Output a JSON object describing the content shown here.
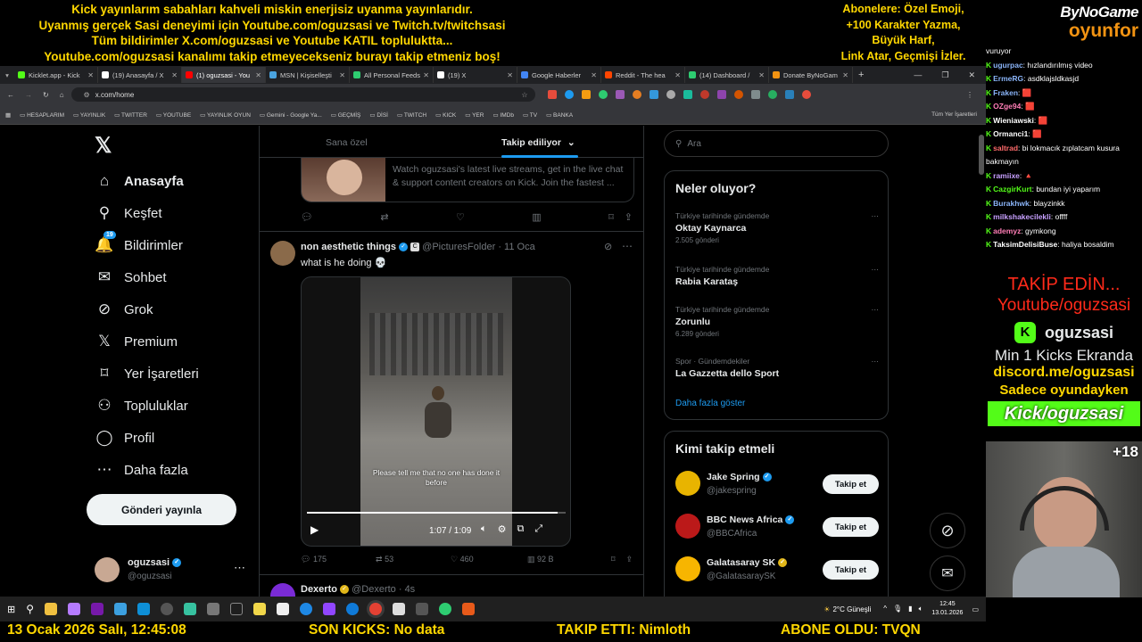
{
  "overlay": {
    "banner_lines": [
      "Kick yayınlarım sabahları kahveli miskin enerjisiz uyanma yayınlarıdır.",
      "Uyanmış gerçek Sasi deneyimi için Youtube.com/oguzsasi ve Twitch.tv/twitchsasi",
      "Tüm bildirimler X.com/oguzsasi ve Youtube KATIL topluluktta...",
      "Youtube.com/oguzsasi kanalımı takip etmeyecekseniz burayı takip etmeniz boş!"
    ],
    "sub_lines": [
      "Abonelere: Özel Emoji,",
      "+100 Karakter Yazma,",
      "Büyük Harf,",
      "Link Atar, Geçmişi İzler."
    ],
    "brand_top": "ByNoGame",
    "brand_bottom": "oyunfor"
  },
  "browser": {
    "tabs": [
      {
        "label": "Kicklet.app - Kick",
        "color": "#53fc18"
      },
      {
        "label": "(19) Anasayfa / X",
        "color": "#ffffff"
      },
      {
        "label": "(1) oguzsasi - You",
        "color": "#ff0000"
      },
      {
        "label": "MSN | Kişiselleşti",
        "color": "#4aa3df"
      },
      {
        "label": "All Personal Feeds",
        "color": "#2ecc71"
      },
      {
        "label": "(19) X",
        "color": "#ffffff"
      },
      {
        "label": "Google Haberler",
        "color": "#4285f4"
      },
      {
        "label": "Reddit - The hea",
        "color": "#ff4500"
      },
      {
        "label": "(14) Dashboard /",
        "color": "#2ecc71"
      },
      {
        "label": "Donate ByNoGam",
        "color": "#f29312"
      }
    ],
    "new_tab": "+",
    "url": "x.com/home",
    "bookmarks": [
      "HESAPLARIM",
      "YAYINLIK",
      "TWITTER",
      "YOUTUBE",
      "YAYINLIK OYUN",
      "Gemini - Google Ya...",
      "GEÇMİŞ",
      "DİSİ",
      "TWITCH",
      "KICK",
      "YER",
      "IMDb",
      "TV",
      "BANKA"
    ],
    "all_bookmarks": "Tüm Yer İşaretleri"
  },
  "x": {
    "nav": [
      {
        "label": "Anasayfa",
        "icon": "home-icon",
        "glyph": "⌂"
      },
      {
        "label": "Keşfet",
        "icon": "search-icon",
        "glyph": "⚲"
      },
      {
        "label": "Bildirimler",
        "icon": "bell-icon",
        "glyph": "🔔"
      },
      {
        "label": "Sohbet",
        "icon": "mail-icon",
        "glyph": "✉"
      },
      {
        "label": "Grok",
        "icon": "grok-icon",
        "glyph": "⊘"
      },
      {
        "label": "Premium",
        "icon": "x-premium-icon",
        "glyph": "𝕏"
      },
      {
        "label": "Yer İşaretleri",
        "icon": "bookmark-icon",
        "glyph": "⌑"
      },
      {
        "label": "Topluluklar",
        "icon": "communities-icon",
        "glyph": "⚇"
      },
      {
        "label": "Profil",
        "icon": "profile-icon",
        "glyph": "◯"
      },
      {
        "label": "Daha fazla",
        "icon": "more-circle-icon",
        "glyph": "⋯"
      }
    ],
    "notif_count": "19",
    "post_button": "Gönderi yayınla",
    "profile": {
      "name": "oguzsasi",
      "handle": "@oguzsasi"
    },
    "tabs": {
      "for_you": "Sana özel",
      "following": "Takip ediliyor"
    },
    "card_text": "Watch oguzsasi's latest live streams, get in the live chat & support content creators on Kick. Join the fastest ...",
    "tweet": {
      "name": "non aesthetic things",
      "handle": "@PicturesFolder",
      "date": "· 11 Oca",
      "text": "what is he doing 💀",
      "caption": "Please tell me that no one has done it before",
      "time": "1:07 / 1:09",
      "replies": "175",
      "retweets": "53",
      "likes": "460",
      "views": "92 B",
      "progress": 0.97
    },
    "next_tweet": {
      "name": "Dexerto",
      "handle": "@Dexerto",
      "date": "· 4s"
    },
    "search_placeholder": "Ara",
    "trends_title": "Neler oluyor?",
    "trends": [
      {
        "context": "Türkiye tarihinde gündemde",
        "name": "Oktay Kaynarca",
        "count": "2.505 gönderi"
      },
      {
        "context": "Türkiye tarihinde gündemde",
        "name": "Rabia Karataş",
        "count": ""
      },
      {
        "context": "Türkiye tarihinde gündemde",
        "name": "Zorunlu",
        "count": "6.289 gönderi"
      },
      {
        "context": "Spor · Gündemdekiler",
        "name": "La Gazzetta dello Sport",
        "count": ""
      }
    ],
    "show_more": "Daha fazla göster",
    "who_title": "Kimi takip etmeli",
    "who": [
      {
        "name": "Jake Spring",
        "handle": "@jakespring",
        "avatar": "#e8b400"
      },
      {
        "name": "BBC News Africa",
        "handle": "@BBCAfrica",
        "avatar": "#bb1919"
      },
      {
        "name": "Galatasaray SK",
        "handle": "@GalatasaraySK",
        "avatar": "#f7b500"
      }
    ],
    "follow_label": "Takip et"
  },
  "chat": [
    {
      "user": "",
      "msg": "vuruyor",
      "color": "#ffffff"
    },
    {
      "user": "ugurpac",
      "msg": ": hızlandırılmış video",
      "color": "#8ab4f8"
    },
    {
      "user": "ErmeRG",
      "msg": ": asdklajsldkasjd",
      "color": "#8ab4f8"
    },
    {
      "user": "Fraken",
      "msg": ": 🟥",
      "color": "#8ab4f8"
    },
    {
      "user": "OZge94",
      "msg": ": 🟥",
      "color": "#ff7eb6"
    },
    {
      "user": "Wieniawski",
      "msg": ": 🟥",
      "color": "#ffffff"
    },
    {
      "user": "Ormanci1",
      "msg": ": 🟥",
      "color": "#ffffff"
    },
    {
      "user": "saltrad",
      "msg": ": bi lokmacık zıplatcam kusura bakmayın",
      "color": "#ff6b6b"
    },
    {
      "user": "ramiixe",
      "msg": ": 🔺",
      "color": "#c7a0ff"
    },
    {
      "user": "CazgirKurt",
      "msg": ": bundan iyi yaparım",
      "color": "#53fc18"
    },
    {
      "user": "Burakhwk",
      "msg": ": blayzinkk",
      "color": "#8ab4f8"
    },
    {
      "user": "milkshakecilekli",
      "msg": ": offff",
      "color": "#c7a0ff"
    },
    {
      "user": "ademyz",
      "msg": ": gymkong",
      "color": "#ff7eb6"
    },
    {
      "user": "TaksimDelisiBuse",
      "msg": ": haliya bosaldim",
      "color": "#ffffff"
    }
  ],
  "promo": {
    "follow": "TAKİP EDİN...",
    "youtube": "Youtube/oguzsasi",
    "kick_name": "oguzsasi",
    "min_kicks": "Min 1 Kicks Ekranda",
    "discord": "discord.me/oguzsasi",
    "only_game": "Sadece oyundayken",
    "kick_url": "Kick/oguzsasi",
    "age": "+18"
  },
  "taskbar": {
    "weather": "2°C Güneşli",
    "time": "12:45",
    "date": "13.01.2026"
  },
  "ticker": {
    "datetime": "13 Ocak 2026 Salı, 12:45:08",
    "son_kicks": "SON KICKS: No data",
    "takip": "TAKIP ETTI: Nimloth",
    "abone": "ABONE OLDU: TVQN"
  }
}
